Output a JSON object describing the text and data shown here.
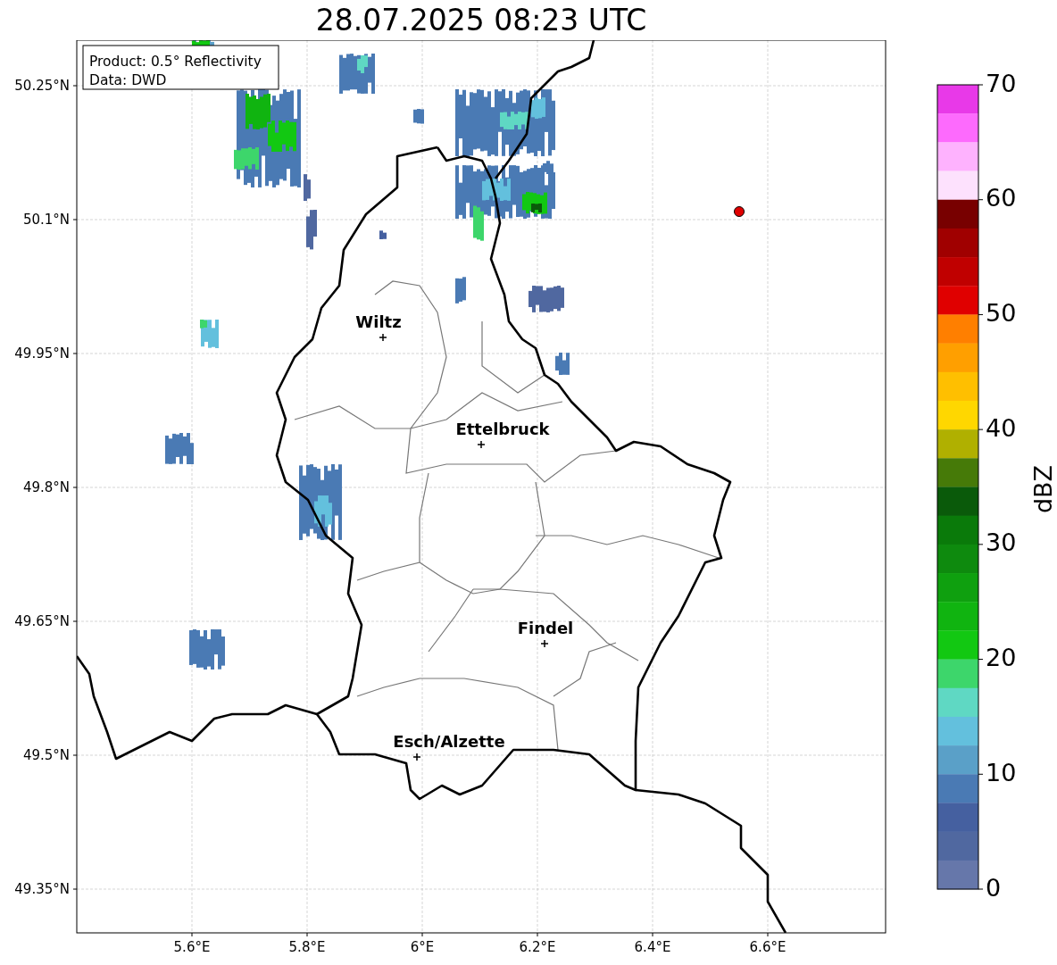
{
  "title": "28.07.2025 08:23 UTC",
  "info_box": {
    "lines": [
      "Product: 0.5° Reflectivity",
      "Data: DWD"
    ]
  },
  "map": {
    "lat_ticks": [
      "50.25°N",
      "50.1°N",
      "49.95°N",
      "49.8°N",
      "49.65°N",
      "49.5°N",
      "49.35°N"
    ],
    "lon_ticks": [
      "5.6°E",
      "5.8°E",
      "6°E",
      "6.2°E",
      "6.4°E",
      "6.6°E"
    ],
    "cities": [
      {
        "name": "Wiltz"
      },
      {
        "name": "Ettelbruck"
      },
      {
        "name": "Findel"
      },
      {
        "name": "Esch/Alzette"
      }
    ]
  },
  "colorbar": {
    "label": "dBZ",
    "ticks": [
      "70",
      "60",
      "50",
      "40",
      "30",
      "20",
      "10",
      "0"
    ],
    "bins": [
      {
        "color": "#e839e8"
      },
      {
        "color": "#fd6afd"
      },
      {
        "color": "#feb2fe"
      },
      {
        "color": "#fde1fd"
      },
      {
        "color": "#780000"
      },
      {
        "color": "#a00000"
      },
      {
        "color": "#c00000"
      },
      {
        "color": "#e00000"
      },
      {
        "color": "#ff7f00"
      },
      {
        "color": "#ff9f00"
      },
      {
        "color": "#ffbf00"
      },
      {
        "color": "#ffd700"
      },
      {
        "color": "#b0b000"
      },
      {
        "color": "#467a08"
      },
      {
        "color": "#0a5a0a"
      },
      {
        "color": "#0a7a0a"
      },
      {
        "color": "#0e8a0e"
      },
      {
        "color": "#0fa00f"
      },
      {
        "color": "#10b410"
      },
      {
        "color": "#12c812"
      },
      {
        "color": "#3dd66b"
      },
      {
        "color": "#5fd8c3"
      },
      {
        "color": "#63c0dd"
      },
      {
        "color": "#5aa0c8"
      },
      {
        "color": "#4a7ab4"
      },
      {
        "color": "#4560a0"
      },
      {
        "color": "#5068a0"
      },
      {
        "color": "#6677aa"
      }
    ]
  }
}
